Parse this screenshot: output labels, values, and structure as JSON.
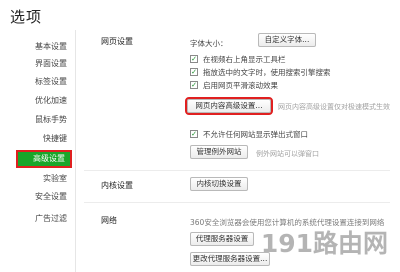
{
  "page": {
    "title": "选项"
  },
  "sidebar": {
    "items": [
      {
        "label": "基本设置"
      },
      {
        "label": "界面设置"
      },
      {
        "label": "标签设置"
      },
      {
        "label": "优化加速"
      },
      {
        "label": "鼠标手势"
      },
      {
        "label": "快捷键"
      },
      {
        "label": "高级设置",
        "active": true
      },
      {
        "label": "实验室"
      },
      {
        "label": "安全设置"
      },
      {
        "label": "广告过滤"
      }
    ]
  },
  "webpage_settings": {
    "heading": "网页设置",
    "font_size_label": "字体大小：",
    "custom_font_button": "自定义字体...",
    "options": [
      {
        "label": "在视频右上角显示工具栏",
        "checked": true
      },
      {
        "label": "拖放选中的文字时，使用搜索引擎搜索",
        "checked": true
      },
      {
        "label": "启用网页平滑滚动效果",
        "checked": true
      }
    ],
    "advanced_content_button": "网页内容高级设置...",
    "advanced_content_hint": "网页内容高级设置仅对极速模式生效",
    "popup_option": {
      "label": "不允许任何网站显示弹出式窗口",
      "checked": true
    },
    "exceptions_button": "管理例外网站",
    "exceptions_hint": "例外网站可以弹窗口"
  },
  "kernel_settings": {
    "heading": "内核设置",
    "switch_button": "内核切换设置"
  },
  "network": {
    "heading": "网络",
    "description": "360安全浏览器会使用您计算机的系统代理设置连接到网络",
    "proxy_button": "代理服务器设置",
    "change_proxy_button": "更改代理服务器设置..."
  },
  "watermark": "191路由网",
  "colors": {
    "active_nav_bg": "#19a62a",
    "highlight_border": "#e02020",
    "check": "#1a8f2a"
  }
}
